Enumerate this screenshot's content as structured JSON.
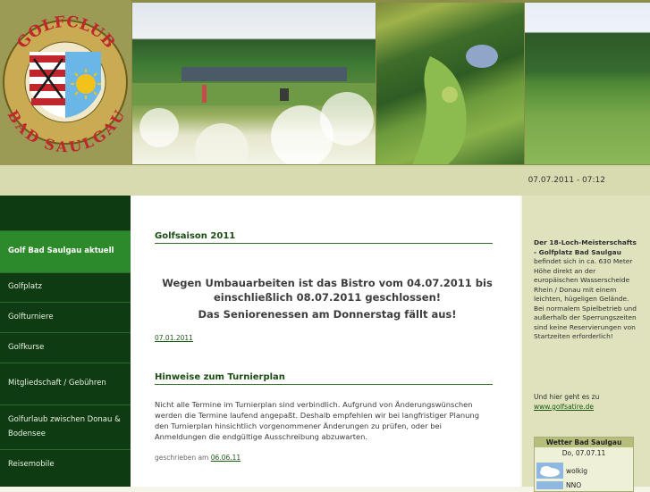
{
  "header": {
    "logo_top_text": "GOLFCLUB",
    "logo_bottom_text": "BAD SAULGAU"
  },
  "datebar": {
    "datetime": "07.07.2011 - 07:12"
  },
  "nav": {
    "items": [
      {
        "label": "Golf Bad Saulgau aktuell",
        "active": true
      },
      {
        "label": "Golfplatz"
      },
      {
        "label": "Golfturniere"
      },
      {
        "label": "Golfkurse"
      },
      {
        "label": "Mitgliedschaft / Gebühren"
      },
      {
        "label": "Golfurlaub zwischen Donau & Bodensee"
      },
      {
        "label": "Reisemobile"
      }
    ]
  },
  "main": {
    "section1_title": "Golfsaison 2011",
    "notice_line1": "Wegen Umbauarbeiten ist das Bistro vom 04.07.2011 bis einschließlich 08.07.2011 geschlossen!",
    "notice_line2": "Das Seniorenessen am Donnerstag fällt aus!",
    "section1_date": "07.01.2011",
    "section2_title": "Hinweise zum Turnierplan",
    "section2_text": "Nicht alle Termine im Turnierplan sind verbindlich. Aufgrund von Änderungswünschen werden die Termine laufend angepaßt. Deshalb empfehlen wir bei langfristiger Planung den Turnierplan hinsichtlich vorgenommener Änderungen zu prüfen, oder bei Anmeldungen die endgültige Ausschreibung abzuwarten.",
    "written_prefix": "geschrieben am",
    "written_date": "06.06.11"
  },
  "right": {
    "info_bold": "Der 18-Loch-Meisterschafts - Golfplatz Bad Saulgau",
    "info_rest": " befindet sich in ca. 630 Meter Höhe direkt an der europäischen Wasserscheide Rhein / Donau mit einem leichten, hügeligen Gelände. Bei normalem Spielbetrieb und außerhalb der Sperrungszeiten sind keine Reservierungen von Startzeiten erforderlich!",
    "golfsatire_text": "Und hier geht es zu",
    "golfsatire_link": "www.golfsatire.de",
    "weather_title": "Wetter Bad Saulgau",
    "weather_date": "Do, 07.07.11",
    "weather_cond": "wolkig",
    "weather_wind": "NNO"
  },
  "colors": {
    "nav_bg": "#0f3b12",
    "nav_active": "#2c8a2a",
    "accent_green": "#1a4d12",
    "logo_red": "#c0262b",
    "logo_blue": "#6ab6e6",
    "logo_gold": "#d9a21c"
  }
}
